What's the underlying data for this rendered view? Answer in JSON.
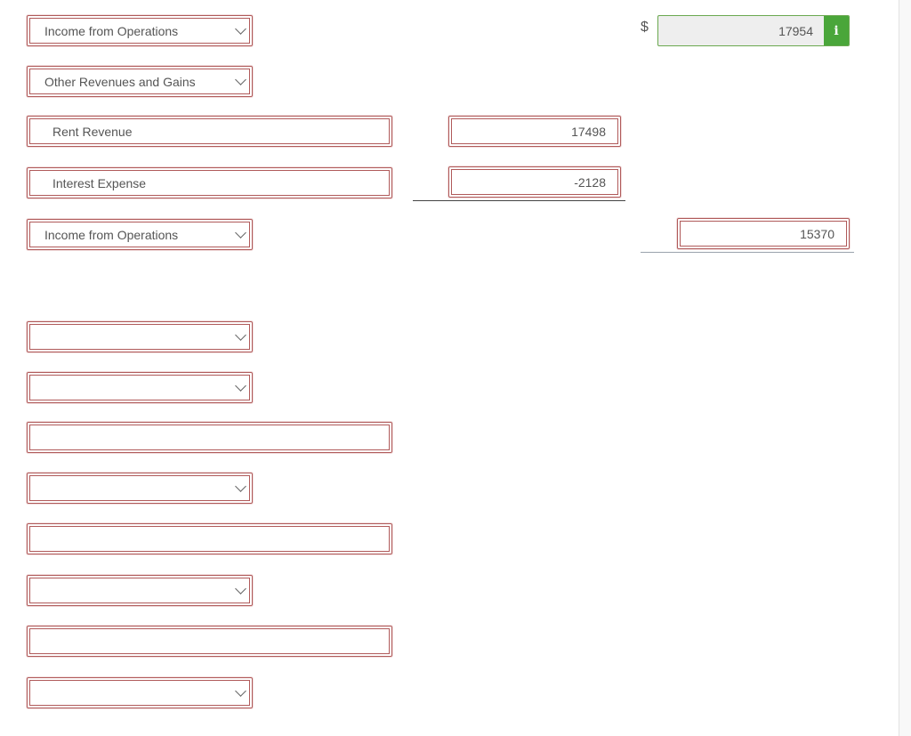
{
  "rows": {
    "r1_select": "Income from Operations",
    "r2_select": "Other Revenues and Gains",
    "r3_text": "Rent Revenue",
    "r3_amount": "17498",
    "r4_text": "Interest Expense",
    "r4_amount": "-2128",
    "r5_select": "Income from Operations",
    "r5_total": "15370"
  },
  "top_total": {
    "currency": "$",
    "value": "17954",
    "info_icon": "i"
  },
  "empty_fields": {
    "select_1": "",
    "select_2": "",
    "text_1": "",
    "select_3": "",
    "text_2": "",
    "select_4": "",
    "text_3": "",
    "select_5": ""
  },
  "colors": {
    "error_border": "#b05a5a",
    "correct_border": "#6aa84f",
    "info_button": "#4aa63a"
  }
}
